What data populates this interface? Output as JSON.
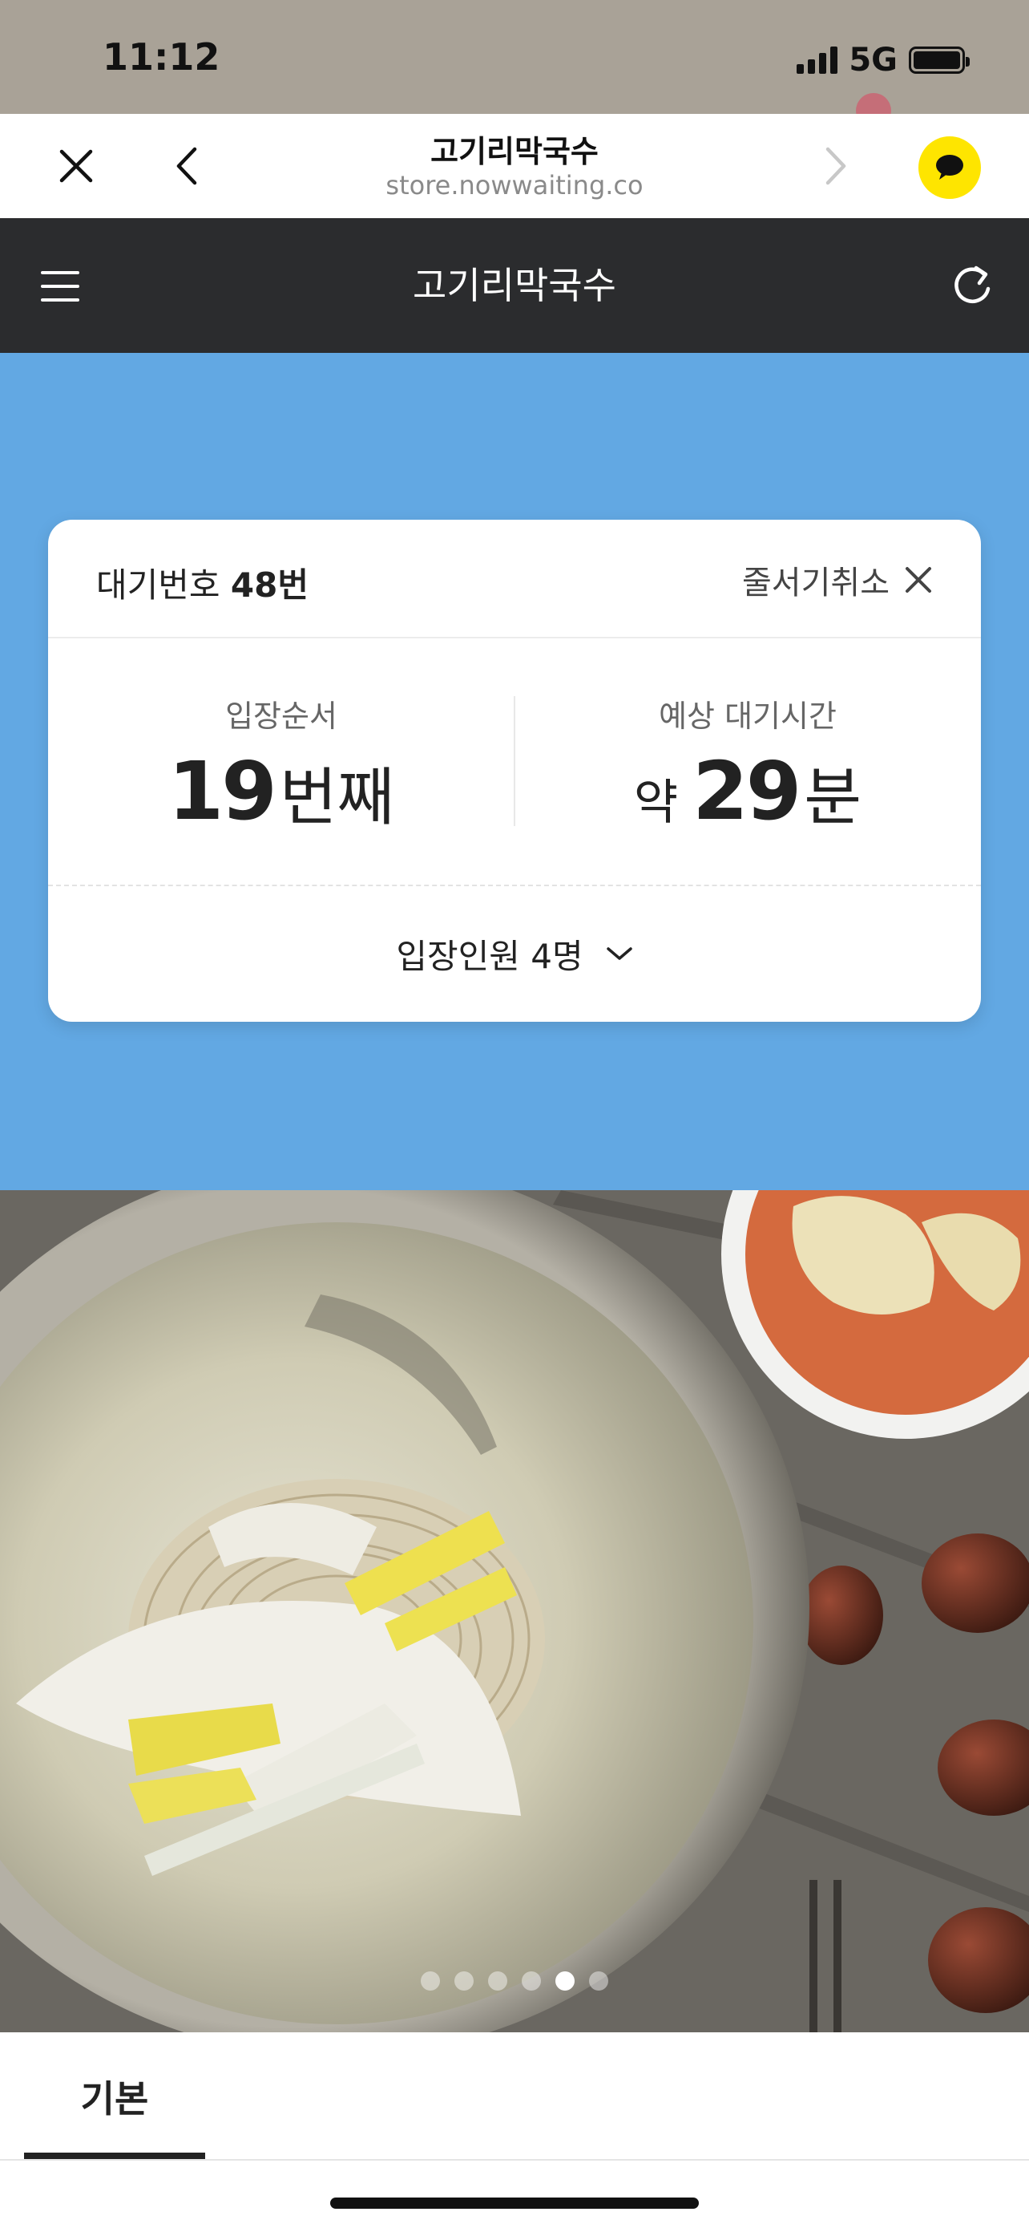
{
  "status_bar": {
    "time": "11:12",
    "network": "5G"
  },
  "browser": {
    "title": "고기리막국수",
    "url": "store.nowwaiting.co",
    "icons": [
      "close-icon",
      "back-icon",
      "forward-icon",
      "kakao-chat-icon"
    ]
  },
  "app_bar": {
    "title": "고기리막국수",
    "icons": [
      "hamburger-menu-icon",
      "refresh-icon"
    ]
  },
  "waiting_card": {
    "wait_label": "대기번호",
    "wait_number": "48번",
    "cancel_label": "줄서기취소",
    "order_label": "입장순서",
    "order_value": "19",
    "order_unit": "번째",
    "time_label": "예상 대기시간",
    "time_prefix": "약",
    "time_value": "29",
    "time_unit": "분",
    "guests_label": "입장인원 4명"
  },
  "carousel": {
    "total_slides": 6,
    "active_index": 4
  },
  "tabs": [
    {
      "label": "기본",
      "active": true
    }
  ],
  "colors": {
    "app_bar": "#2b2c2e",
    "banner": "#62a8e3",
    "kakao": "#fee500"
  }
}
